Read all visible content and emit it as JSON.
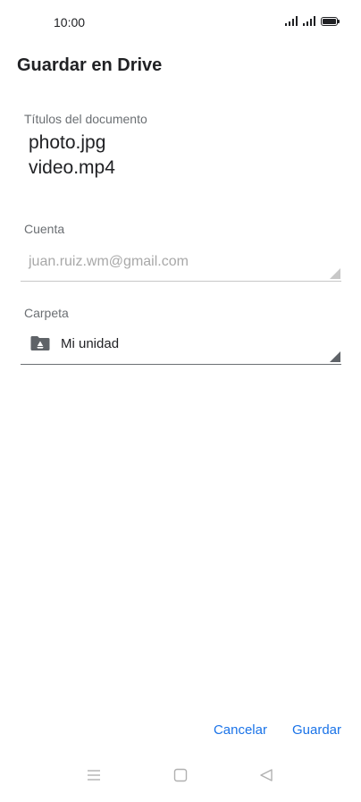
{
  "status_bar": {
    "time": "10:00",
    "icons": [
      "signal-icon",
      "signal-icon",
      "battery-icon"
    ]
  },
  "dialog": {
    "title": "Guardar en Drive",
    "documents_label": "Títulos del documento",
    "documents": [
      "photo.jpg",
      "video.mp4"
    ],
    "account_label": "Cuenta",
    "account_value": "juan.ruiz.wm@gmail.com",
    "folder_label": "Carpeta",
    "folder_value": "Mi unidad",
    "folder_icon": "drive-folder-icon",
    "cancel_label": "Cancelar",
    "save_label": "Guardar"
  },
  "nav_bar": {
    "icons": [
      "menu-icon",
      "home-icon",
      "back-icon"
    ]
  },
  "colors": {
    "accent": "#1a73e8",
    "text": "#202124",
    "muted": "#6b6f73",
    "disabled": "#a8a8a8"
  }
}
